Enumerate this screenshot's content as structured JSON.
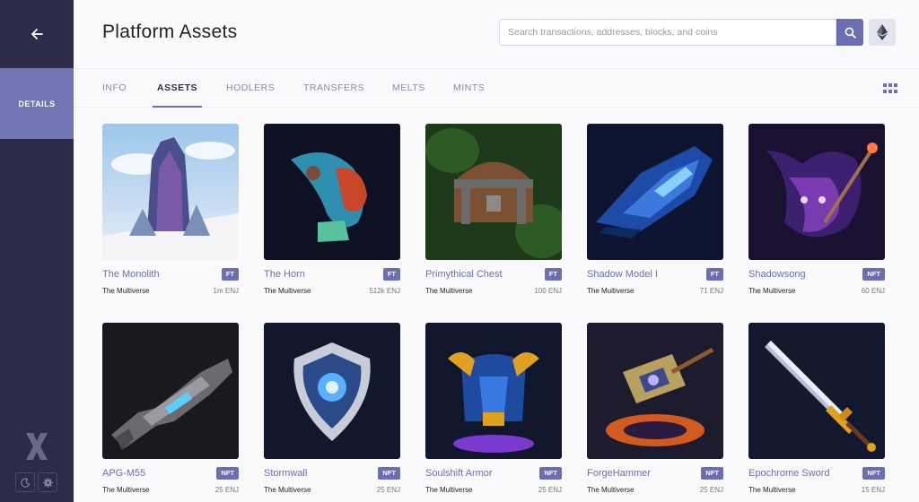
{
  "sidebar": {
    "details_label": "DETAILS"
  },
  "header": {
    "title": "Platform Assets",
    "search_placeholder": "Search transactions, addresses, blocks, and coins"
  },
  "tabs": [
    {
      "label": "INFO"
    },
    {
      "label": "ASSETS"
    },
    {
      "label": "HODLERS"
    },
    {
      "label": "TRANSFERS"
    },
    {
      "label": "MELTS"
    },
    {
      "label": "MINTS"
    }
  ],
  "active_tab": "ASSETS",
  "colors": {
    "accent": "#6b6eb0",
    "sidebar": "#2c2c48",
    "sidebar_active": "#7275b4"
  },
  "assets": [
    {
      "name": "The Monolith",
      "type": "FT",
      "owner": "The Multiverse",
      "supply": "1m ENJ",
      "art": "monolith"
    },
    {
      "name": "The Horn",
      "type": "FT",
      "owner": "The Multiverse",
      "supply": "512k ENJ",
      "art": "horn"
    },
    {
      "name": "Primythical Chest",
      "type": "FT",
      "owner": "The Multiverse",
      "supply": "100 ENJ",
      "art": "chest"
    },
    {
      "name": "Shadow Model I",
      "type": "FT",
      "owner": "The Multiverse",
      "supply": "71 ENJ",
      "art": "ship"
    },
    {
      "name": "Shadowsong",
      "type": "NFT",
      "owner": "The Multiverse",
      "supply": "60 ENJ",
      "art": "shadowsong"
    },
    {
      "name": "APG-M55",
      "type": "NFT",
      "owner": "The Multiverse",
      "supply": "25 ENJ",
      "art": "gun"
    },
    {
      "name": "Stormwall",
      "type": "NFT",
      "owner": "The Multiverse",
      "supply": "25 ENJ",
      "art": "shield"
    },
    {
      "name": "Soulshift Armor",
      "type": "NFT",
      "owner": "The Multiverse",
      "supply": "25 ENJ",
      "art": "armor"
    },
    {
      "name": "ForgeHammer",
      "type": "NFT",
      "owner": "The Multiverse",
      "supply": "25 ENJ",
      "art": "hammer"
    },
    {
      "name": "Epochrome Sword",
      "type": "NFT",
      "owner": "The Multiverse",
      "supply": "15 ENJ",
      "art": "sword"
    }
  ]
}
